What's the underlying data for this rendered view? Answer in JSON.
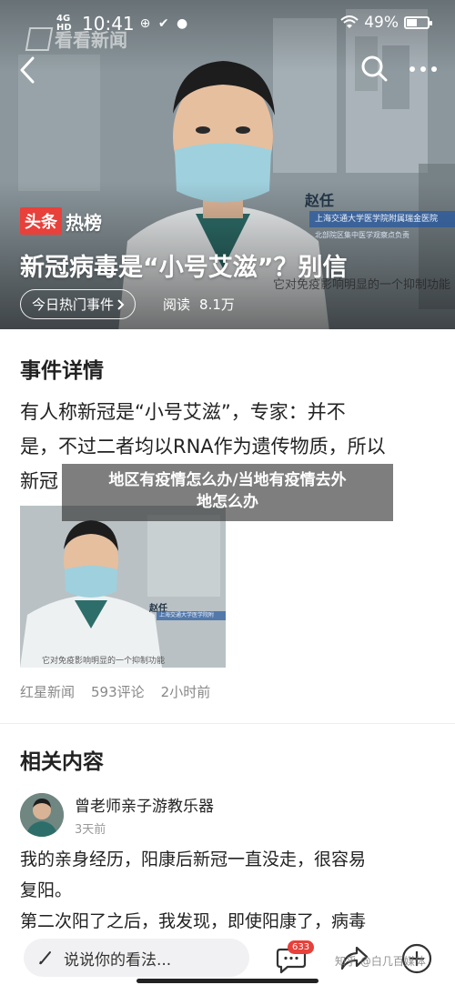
{
  "status_bar": {
    "network": "4G HD",
    "time": "10:41",
    "indicators": "⊕ ✔ ●",
    "battery": "49%",
    "battery_level": 0.49
  },
  "watermark": {
    "text": "看看新闻"
  },
  "hero": {
    "badge_primary": "头条",
    "badge_secondary": "热榜",
    "title": "新冠病毒是“小号艾滋”？别信",
    "event_pill": "今日热门事件",
    "read_label": "阅读",
    "read_count": "8.1万",
    "caption_name": "赵任",
    "caption_org": "上海交通大学医学院附属瑞金医院",
    "caption_org2": "北部院区集中医学观察点负责",
    "caption_subtitle": "它对免疫影响明显的一个抑制功能"
  },
  "event_details": {
    "heading": "事件详情",
    "text_line1": "有人称新冠是“小号艾滋”，专家：并不",
    "text_line2": "是，不过二者均以RNA作为遗传物质，所以",
    "text_line3": "新冠"
  },
  "thumbnail": {
    "name": "赵任",
    "org": "上海交通大学医学院附",
    "subtitle": "它对免疫影响明显的一个抑制功能"
  },
  "source": {
    "name": "红星新闻",
    "comments": "593评论",
    "time": "2小时前"
  },
  "related": {
    "heading": "相关内容",
    "author": "曾老师亲子游教乐器",
    "author_time": "3天前",
    "post_line1": "我的亲身经历，阳康后新冠一直没走，很容易",
    "post_line2": "复阳。",
    "post_line3": "第二次阳了之后，我发现，即使阳康了，病毒"
  },
  "banner": {
    "line1": "地区有疫情怎么办/当地有疫情去外",
    "line2": "地怎么办"
  },
  "bottom_bar": {
    "comment_placeholder": "说说你的看法...",
    "comment_badge": "633",
    "zhihu_mark": "知乎 @白几百媒体"
  }
}
